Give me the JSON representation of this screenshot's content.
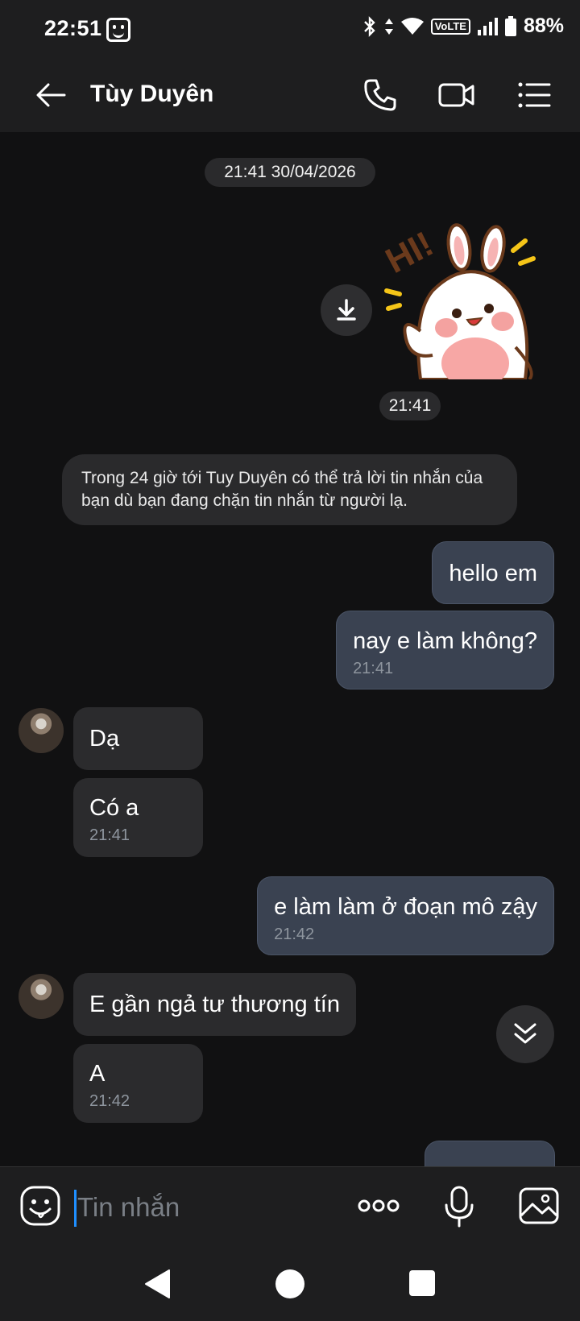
{
  "status_bar": {
    "time": "22:51",
    "volte": "VoLTE",
    "battery": "88%"
  },
  "header": {
    "title": "Tùy Duyên",
    "icons": [
      "back-arrow-icon",
      "phone-icon",
      "video-call-icon",
      "menu-list-icon"
    ]
  },
  "chat": {
    "date_pill": "21:41 30/04/2026",
    "sticker_time": "21:41",
    "sticker_text": "HI!",
    "notice": "Trong 24 giờ tới Tuy Duyên có thể trả lời tin nhắn của bạn dù bạn đang chặn tin nhắn từ người lạ.",
    "messages": [
      {
        "from": "me",
        "text": "hello em",
        "time": ""
      },
      {
        "from": "me",
        "text": "nay e làm không?",
        "time": "21:41"
      },
      {
        "from": "them",
        "text": "Dạ",
        "time": ""
      },
      {
        "from": "them",
        "text": "Có a",
        "time": "21:41"
      },
      {
        "from": "me",
        "text": "e làm làm ở đoạn mô zậy",
        "time": "21:42"
      },
      {
        "from": "them",
        "text": "E gần ngả tư thương tín",
        "time": ""
      },
      {
        "from": "them",
        "text": "A",
        "time": "21:42"
      }
    ]
  },
  "input_bar": {
    "placeholder": "Tin nhắn"
  },
  "colors": {
    "background": "#111112",
    "bar": "#1e1e1f",
    "outgoing_bubble": "#3a4251",
    "incoming_bubble": "#2b2b2d",
    "caret": "#1f8fff"
  }
}
